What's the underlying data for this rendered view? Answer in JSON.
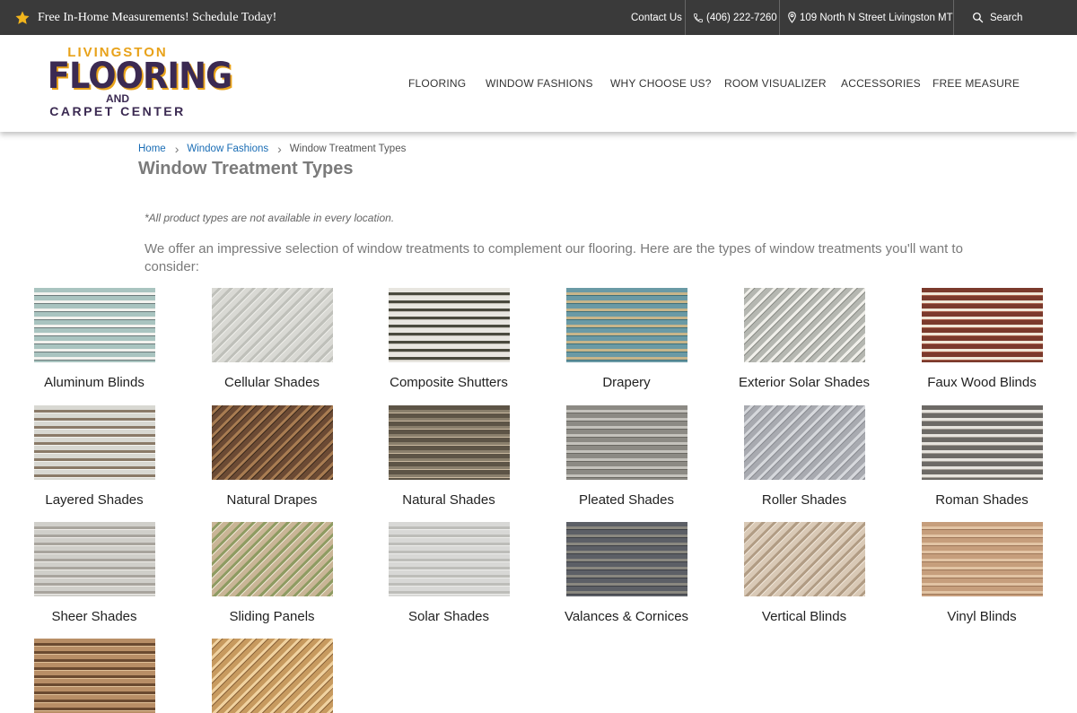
{
  "topbar": {
    "promo": "Free In-Home Measurements! Schedule Today!",
    "contact": "Contact Us",
    "phone": "(406) 222-7260",
    "address": "109 North N Street Livingston MT",
    "search": "Search"
  },
  "logo": {
    "line1": "LIVINGSTON",
    "line2": "FLOORING",
    "line3": "AND",
    "line4": "CARPET CENTER"
  },
  "nav": [
    "FLOORING",
    "WINDOW FASHIONS",
    "WHY CHOOSE US?",
    "ROOM VISUALIZER",
    "ACCESSORIES",
    "FREE MEASURE"
  ],
  "breadcrumb": {
    "home": "Home",
    "parent": "Window Fashions",
    "current": "Window Treatment Types"
  },
  "page": {
    "title": "Window Treatment Types",
    "note": "*All product types are not available in every location.",
    "intro": "We offer an impressive selection of window treatments to complement our flooring. Here are the types of window treatments you'll want to consider:"
  },
  "products": [
    "Aluminum Blinds",
    "Cellular Shades",
    "Composite Shutters",
    "Drapery",
    "Exterior Solar Shades",
    "Faux Wood Blinds",
    "Layered Shades",
    "Natural Drapes",
    "Natural Shades",
    "Pleated Shades",
    "Roller Shades",
    "Roman Shades",
    "Sheer Shades",
    "Sliding Panels",
    "Solar Shades",
    "Valances & Cornices",
    "Vertical Blinds",
    "Vinyl Blinds",
    "",
    ""
  ],
  "colors": {
    "topbar": "#3a3a3a",
    "link": "#1a6db5",
    "logo_gold": "#e8a21a",
    "logo_purple": "#3b2a52"
  }
}
